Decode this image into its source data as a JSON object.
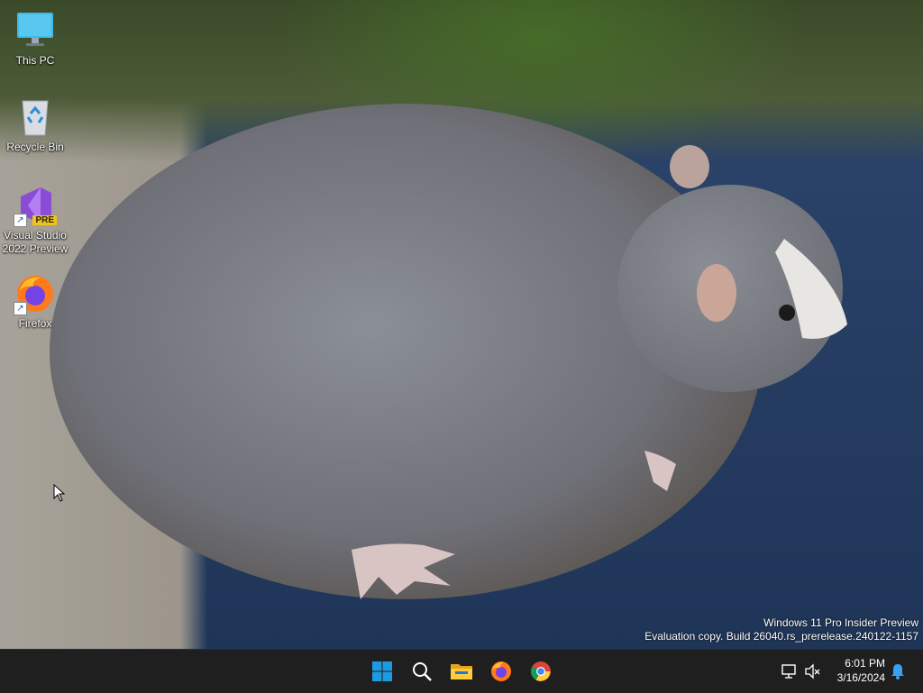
{
  "desktop": {
    "icons": [
      {
        "label": "This PC",
        "icon": "monitor-icon"
      },
      {
        "label": "Recycle Bin",
        "icon": "recycle-bin-icon"
      },
      {
        "label": "Visual Studio 2022 Preview",
        "icon": "visual-studio-preview-icon",
        "badge": "PRE"
      },
      {
        "label": "Firefox",
        "icon": "firefox-icon"
      }
    ],
    "watermark": {
      "line1": "Windows 11 Pro Insider Preview",
      "line2": "Evaluation copy. Build 26040.rs_prerelease.240122-1157"
    }
  },
  "taskbar": {
    "apps": [
      "start-icon",
      "search-icon",
      "file-explorer-icon",
      "firefox-icon",
      "chrome-icon"
    ],
    "clock": {
      "time": "6:01 PM",
      "date": "3/16/2024"
    },
    "tray": [
      "network-icon",
      "volume-muted-icon",
      "notification-bell-icon"
    ]
  },
  "colors": {
    "taskbar": "#1f1f1f",
    "accent": "#1e9ae0"
  }
}
